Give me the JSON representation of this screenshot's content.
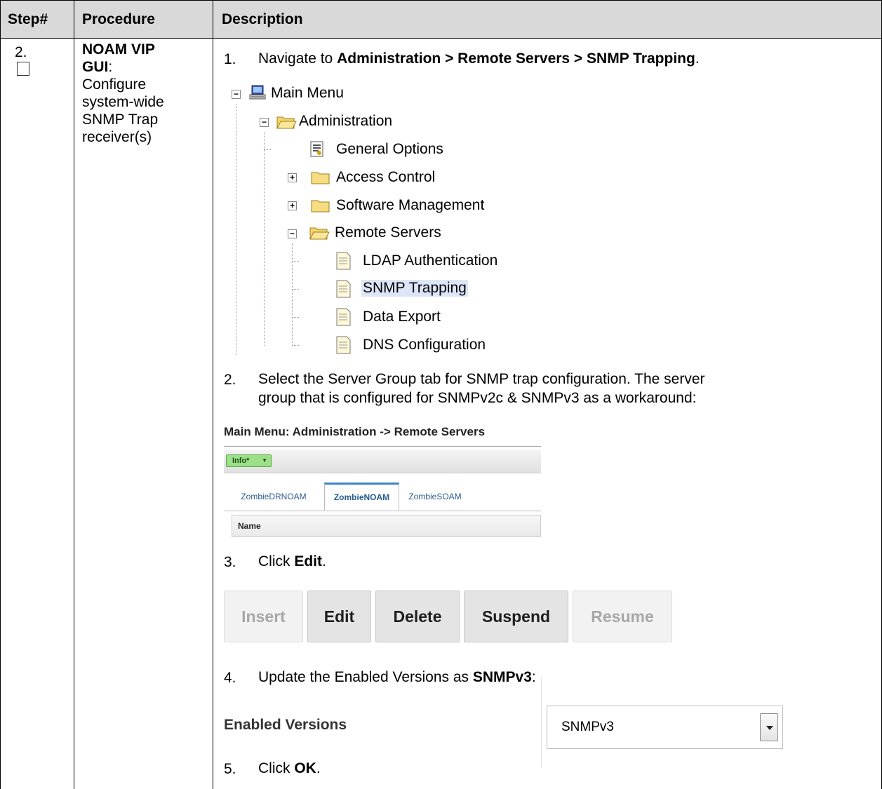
{
  "table": {
    "headers": {
      "step": "Step#",
      "procedure": "Procedure",
      "description": "Description"
    },
    "step_number": "2.",
    "procedure": {
      "bold": "NOAM VIP GUI",
      "line1": "NOAM VIP",
      "line2": "GUI",
      "rest": [
        "Configure",
        "system-wide",
        "SNMP Trap",
        "receiver(s)"
      ]
    }
  },
  "steps": [
    {
      "num": "1.",
      "pre": "Navigate to ",
      "bold": "Administration > Remote Servers > SNMP Trapping",
      "post": "."
    },
    {
      "num": "2.",
      "line1": "Select the Server Group tab for SNMP trap configuration.  The server",
      "line2": "group that is configured for SNMPv2c & SNMPv3 as a workaround:"
    },
    {
      "num": "3.",
      "pre": "Click ",
      "bold": "Edit",
      "post": "."
    },
    {
      "num": "4.",
      "pre": "Update the Enabled Versions as ",
      "bold": "SNMPv3",
      "post": ":"
    },
    {
      "num": "5.",
      "pre": "Click ",
      "bold": "OK",
      "post": "."
    }
  ],
  "tree": {
    "main_menu": "Main Menu",
    "administration": "Administration",
    "general_options": "General Options",
    "access_control": "Access Control",
    "software_management": "Software Management",
    "remote_servers": "Remote Servers",
    "ldap": "LDAP Authentication",
    "snmp": "SNMP Trapping",
    "data_export": "Data Export",
    "dns": "DNS Configuration"
  },
  "mini": {
    "title": "Main Menu: Administration -> Remote Servers",
    "info_button": "Info*",
    "tabs": [
      "ZombieDRNOAM",
      "ZombieNOAM",
      "ZombieSOAM"
    ],
    "active_tab": "ZombieNOAM",
    "column_header": "Name"
  },
  "buttons": {
    "insert": "Insert",
    "edit": "Edit",
    "delete": "Delete",
    "suspend": "Suspend",
    "resume": "Resume"
  },
  "enabled_versions": {
    "label": "Enabled Versions",
    "value": "SNMPv3"
  },
  "colors": {
    "header_bg": "#d9d9d9",
    "info_green": "#9de089",
    "tab_accent": "#3a86c8",
    "selection": "#dde6f7"
  }
}
